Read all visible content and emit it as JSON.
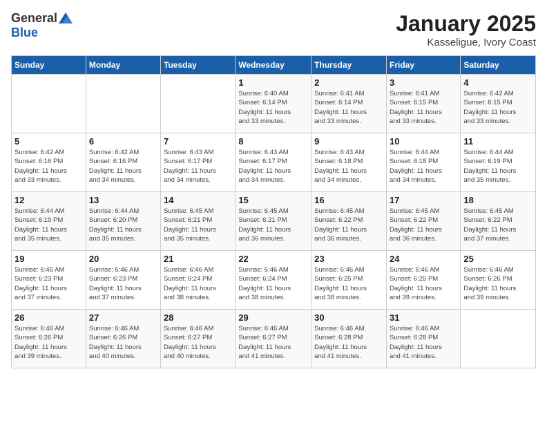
{
  "header": {
    "logo_general": "General",
    "logo_blue": "Blue",
    "month_title": "January 2025",
    "location": "Kasseligue, Ivory Coast"
  },
  "days_of_week": [
    "Sunday",
    "Monday",
    "Tuesday",
    "Wednesday",
    "Thursday",
    "Friday",
    "Saturday"
  ],
  "weeks": [
    [
      {
        "day": "",
        "info": ""
      },
      {
        "day": "",
        "info": ""
      },
      {
        "day": "",
        "info": ""
      },
      {
        "day": "1",
        "info": "Sunrise: 6:40 AM\nSunset: 6:14 PM\nDaylight: 11 hours\nand 33 minutes."
      },
      {
        "day": "2",
        "info": "Sunrise: 6:41 AM\nSunset: 6:14 PM\nDaylight: 11 hours\nand 33 minutes."
      },
      {
        "day": "3",
        "info": "Sunrise: 6:41 AM\nSunset: 6:15 PM\nDaylight: 11 hours\nand 33 minutes."
      },
      {
        "day": "4",
        "info": "Sunrise: 6:42 AM\nSunset: 6:15 PM\nDaylight: 11 hours\nand 33 minutes."
      }
    ],
    [
      {
        "day": "5",
        "info": "Sunrise: 6:42 AM\nSunset: 6:16 PM\nDaylight: 11 hours\nand 33 minutes."
      },
      {
        "day": "6",
        "info": "Sunrise: 6:42 AM\nSunset: 6:16 PM\nDaylight: 11 hours\nand 34 minutes."
      },
      {
        "day": "7",
        "info": "Sunrise: 6:43 AM\nSunset: 6:17 PM\nDaylight: 11 hours\nand 34 minutes."
      },
      {
        "day": "8",
        "info": "Sunrise: 6:43 AM\nSunset: 6:17 PM\nDaylight: 11 hours\nand 34 minutes."
      },
      {
        "day": "9",
        "info": "Sunrise: 6:43 AM\nSunset: 6:18 PM\nDaylight: 11 hours\nand 34 minutes."
      },
      {
        "day": "10",
        "info": "Sunrise: 6:44 AM\nSunset: 6:18 PM\nDaylight: 11 hours\nand 34 minutes."
      },
      {
        "day": "11",
        "info": "Sunrise: 6:44 AM\nSunset: 6:19 PM\nDaylight: 11 hours\nand 35 minutes."
      }
    ],
    [
      {
        "day": "12",
        "info": "Sunrise: 6:44 AM\nSunset: 6:19 PM\nDaylight: 11 hours\nand 35 minutes."
      },
      {
        "day": "13",
        "info": "Sunrise: 6:44 AM\nSunset: 6:20 PM\nDaylight: 11 hours\nand 35 minutes."
      },
      {
        "day": "14",
        "info": "Sunrise: 6:45 AM\nSunset: 6:21 PM\nDaylight: 11 hours\nand 35 minutes."
      },
      {
        "day": "15",
        "info": "Sunrise: 6:45 AM\nSunset: 6:21 PM\nDaylight: 11 hours\nand 36 minutes."
      },
      {
        "day": "16",
        "info": "Sunrise: 6:45 AM\nSunset: 6:22 PM\nDaylight: 11 hours\nand 36 minutes."
      },
      {
        "day": "17",
        "info": "Sunrise: 6:45 AM\nSunset: 6:22 PM\nDaylight: 11 hours\nand 36 minutes."
      },
      {
        "day": "18",
        "info": "Sunrise: 6:45 AM\nSunset: 6:22 PM\nDaylight: 11 hours\nand 37 minutes."
      }
    ],
    [
      {
        "day": "19",
        "info": "Sunrise: 6:45 AM\nSunset: 6:23 PM\nDaylight: 11 hours\nand 37 minutes."
      },
      {
        "day": "20",
        "info": "Sunrise: 6:46 AM\nSunset: 6:23 PM\nDaylight: 11 hours\nand 37 minutes."
      },
      {
        "day": "21",
        "info": "Sunrise: 6:46 AM\nSunset: 6:24 PM\nDaylight: 11 hours\nand 38 minutes."
      },
      {
        "day": "22",
        "info": "Sunrise: 6:46 AM\nSunset: 6:24 PM\nDaylight: 11 hours\nand 38 minutes."
      },
      {
        "day": "23",
        "info": "Sunrise: 6:46 AM\nSunset: 6:25 PM\nDaylight: 11 hours\nand 38 minutes."
      },
      {
        "day": "24",
        "info": "Sunrise: 6:46 AM\nSunset: 6:25 PM\nDaylight: 11 hours\nand 39 minutes."
      },
      {
        "day": "25",
        "info": "Sunrise: 6:46 AM\nSunset: 6:26 PM\nDaylight: 11 hours\nand 39 minutes."
      }
    ],
    [
      {
        "day": "26",
        "info": "Sunrise: 6:46 AM\nSunset: 6:26 PM\nDaylight: 11 hours\nand 39 minutes."
      },
      {
        "day": "27",
        "info": "Sunrise: 6:46 AM\nSunset: 6:26 PM\nDaylight: 11 hours\nand 40 minutes."
      },
      {
        "day": "28",
        "info": "Sunrise: 6:46 AM\nSunset: 6:27 PM\nDaylight: 11 hours\nand 40 minutes."
      },
      {
        "day": "29",
        "info": "Sunrise: 6:46 AM\nSunset: 6:27 PM\nDaylight: 11 hours\nand 41 minutes."
      },
      {
        "day": "30",
        "info": "Sunrise: 6:46 AM\nSunset: 6:28 PM\nDaylight: 11 hours\nand 41 minutes."
      },
      {
        "day": "31",
        "info": "Sunrise: 6:46 AM\nSunset: 6:28 PM\nDaylight: 11 hours\nand 41 minutes."
      },
      {
        "day": "",
        "info": ""
      }
    ]
  ]
}
